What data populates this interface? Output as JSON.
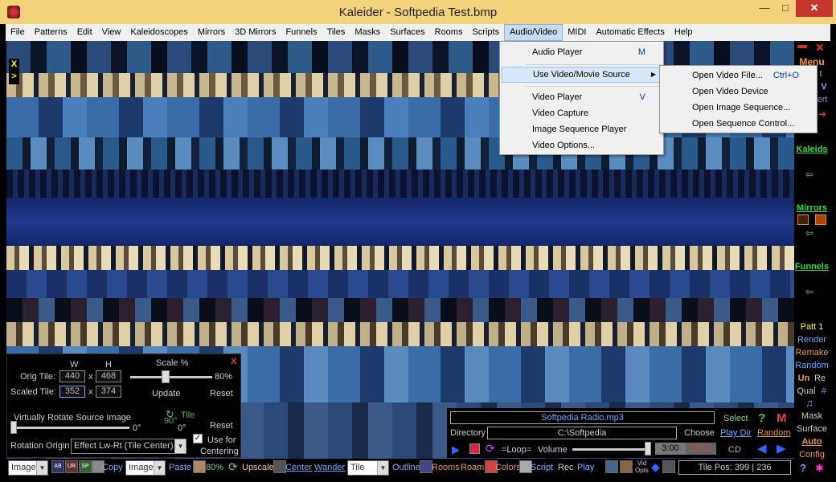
{
  "window": {
    "title": "Kaleider - Softpedia Test.bmp",
    "min": "—",
    "max": "□",
    "close": "✕"
  },
  "menu": [
    "File",
    "Patterns",
    "Edit",
    "View",
    "Kaleidoscopes",
    "Mirrors",
    "3D Mirrors",
    "Funnels",
    "Tiles",
    "Masks",
    "Surfaces",
    "Rooms",
    "Scripts",
    "Audio/Video",
    "MIDI",
    "Automatic Effects",
    "Help"
  ],
  "av_menu": {
    "audio_player": "Audio Player",
    "audio_player_sc": "M",
    "use_video": "Use Video/Movie Source",
    "video_player": "Video Player",
    "video_player_sc": "V",
    "video_capture": "Video Capture",
    "image_seq_player": "Image Sequence Player",
    "video_options": "Video Options..."
  },
  "video_submenu": {
    "open_file": "Open Video File...",
    "open_file_sc": "Ctrl+O",
    "open_device": "Open Video Device",
    "open_image_seq": "Open Image Sequence...",
    "open_seq_control": "Open Sequence Control..."
  },
  "canvas_left": {
    "x": "X",
    "arrow": ">"
  },
  "sidebar": {
    "menu": "Menu",
    "t": "t",
    "v": "V",
    "ert": "ert",
    "kaleids": "Kaleids",
    "mirrors": "Mirrors",
    "funnels": "Funnels",
    "patt": "Patt 1",
    "render": "Render",
    "remake": "Remake",
    "random": "Random",
    "un": "Un",
    "re": "Re",
    "qual": "Qual",
    "hash": "#",
    "mask": "Mask",
    "surface": "Surface",
    "auto": "Auto",
    "config": "Config",
    "help": "?"
  },
  "tile_panel": {
    "close": "X",
    "w": "W",
    "h": "H",
    "scale": "Scale %",
    "orig_tile": "Orig Tile:",
    "orig_w": "440",
    "orig_h": "468",
    "scaled_tile": "Scaled Tile:",
    "scaled_w": "352",
    "scaled_h": "374",
    "x1": "x",
    "x2": "x",
    "scale_pct": "80%",
    "scale_value": 0.8,
    "update": "Update",
    "reset": "Reset",
    "rotate": "Virtually Rotate Source Image",
    "rot_val": "0°",
    "rot_val2": "0°",
    "ninety": "90°",
    "tile": "Tile",
    "reset2": "Reset",
    "rot_origin": "Rotation Origin",
    "rot_origin_val": "Effect Lw-Rt (Tile Center)",
    "use_for": "Use for",
    "centering": "Centering",
    "use_for_checked": true
  },
  "media": {
    "track": "Softpedia Radio.mp3",
    "select": "Select",
    "q": "?",
    "m": "M",
    "directory": "Directory",
    "dir_val": "C:\\Softpedia",
    "choose": "Choose",
    "play_dir": "Play Dir",
    "random": "Random",
    "loop": "=Loop=",
    "volume": "Volume",
    "volume_value": 0.98,
    "t1": "3:00",
    "t2": "3:00",
    "cd": "CD"
  },
  "bottom": {
    "image1": "Image",
    "copy": "Copy",
    "image2": "Image",
    "paste": "Paste",
    "pct": "80%",
    "upscale": "Upscale",
    "center": "Center",
    "wander": "Wander",
    "tile": "Tile",
    "outline": "Outline",
    "rooms": "Rooms",
    "roam": "Roam",
    "colors": "Colors",
    "script": "Script",
    "rec": "Rec",
    "play": "Play",
    "vid": "Vid",
    "opts": "Opts",
    "tilepos": "Tile Pos:  399 | 236",
    "ab": "AB",
    "ur": "UR",
    "sp": "SP"
  },
  "colors": {
    "title_bg": "#f2d27a",
    "close_red": "#c7362c",
    "menu_active": "#c5dcf2",
    "canvas_blue": "#1a2c6a"
  }
}
